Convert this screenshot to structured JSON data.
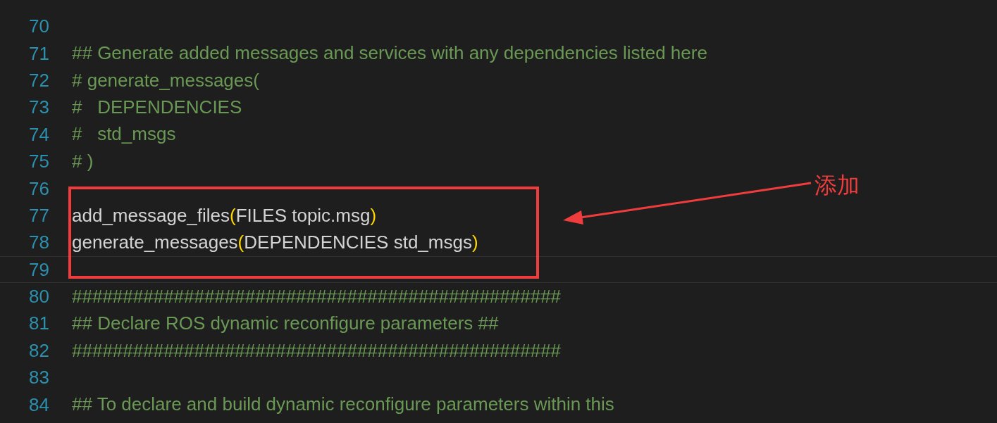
{
  "editor": {
    "lines": [
      {
        "number": "70",
        "current": false
      },
      {
        "number": "71",
        "current": false,
        "tokens": [
          {
            "kind": "comment",
            "text": "## Generate added messages and services with any dependencies listed here"
          }
        ]
      },
      {
        "number": "72",
        "current": false,
        "tokens": [
          {
            "kind": "comment",
            "text": "# generate_messages("
          }
        ]
      },
      {
        "number": "73",
        "current": false,
        "tokens": [
          {
            "kind": "comment",
            "text": "#   DEPENDENCIES"
          }
        ]
      },
      {
        "number": "74",
        "current": false,
        "tokens": [
          {
            "kind": "comment",
            "text": "#   std_msgs"
          }
        ]
      },
      {
        "number": "75",
        "current": false,
        "tokens": [
          {
            "kind": "comment",
            "text": "# )"
          }
        ]
      },
      {
        "number": "76",
        "current": false
      },
      {
        "number": "77",
        "current": false,
        "tokens": [
          {
            "kind": "plain",
            "text": "add_message_files"
          },
          {
            "kind": "paren",
            "text": "("
          },
          {
            "kind": "plain",
            "text": "FILES topic.msg"
          },
          {
            "kind": "paren",
            "text": ")"
          }
        ]
      },
      {
        "number": "78",
        "current": false,
        "tokens": [
          {
            "kind": "plain",
            "text": "generate_messages"
          },
          {
            "kind": "paren",
            "text": "("
          },
          {
            "kind": "plain",
            "text": "DEPENDENCIES std_msgs"
          },
          {
            "kind": "paren",
            "text": ")"
          }
        ]
      },
      {
        "number": "79",
        "current": true
      },
      {
        "number": "80",
        "current": false,
        "tokens": [
          {
            "kind": "comment",
            "text": "################################################"
          }
        ]
      },
      {
        "number": "81",
        "current": false,
        "tokens": [
          {
            "kind": "comment",
            "text": "## Declare ROS dynamic reconfigure parameters ##"
          }
        ]
      },
      {
        "number": "82",
        "current": false,
        "tokens": [
          {
            "kind": "comment",
            "text": "################################################"
          }
        ]
      },
      {
        "number": "83",
        "current": false
      },
      {
        "number": "84",
        "current": false,
        "tokens": [
          {
            "kind": "comment",
            "text": "## To declare and build dynamic reconfigure parameters within this"
          }
        ]
      }
    ]
  },
  "annotation": {
    "label": "添加"
  }
}
